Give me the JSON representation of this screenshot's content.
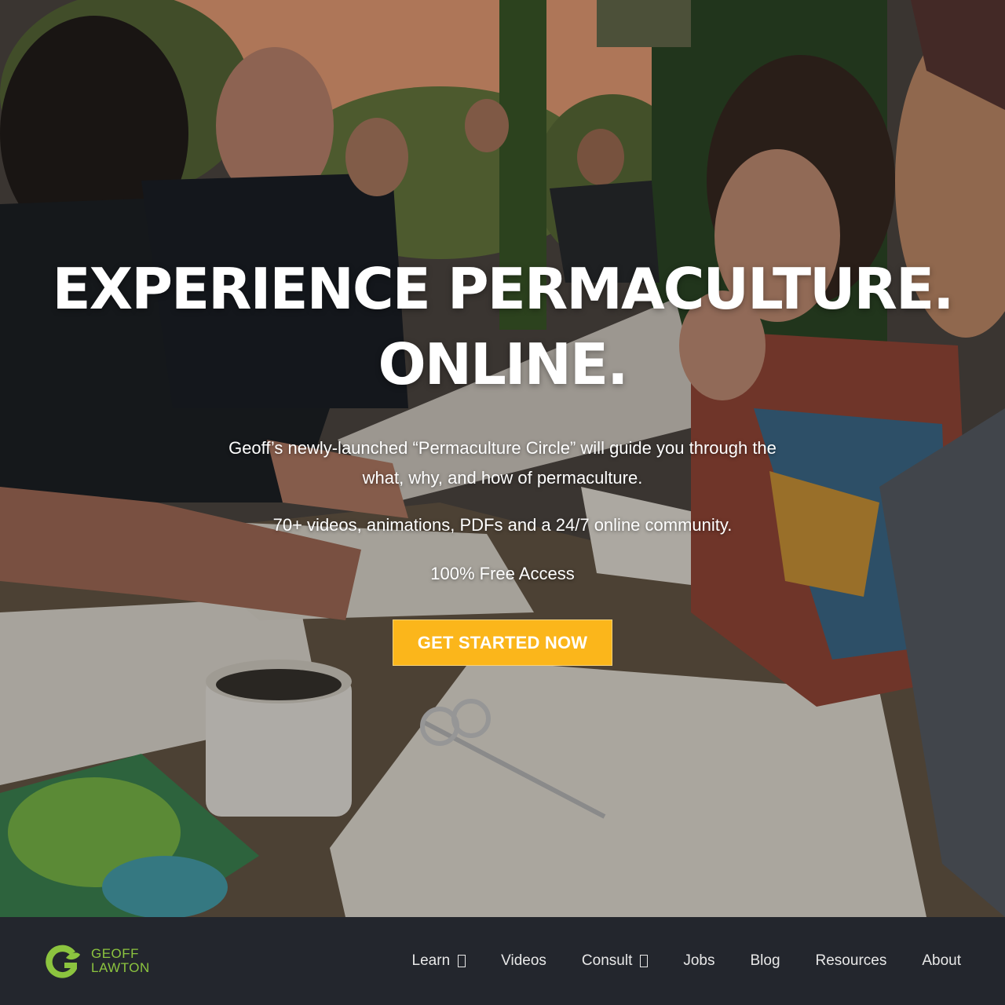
{
  "hero": {
    "headline_line1": "EXPERIENCE PERMACULTURE.",
    "headline_line2": "ONLINE.",
    "description": "Geoff’s newly-launched “Permaculture Circle” will guide you through the what, why, and how of permaculture.",
    "features": "70+ videos, animations, PDFs and a 24/7 online community.",
    "access": "100% Free Access",
    "cta_label": "GET STARTED NOW",
    "background_icon": "photo-people-at-table"
  },
  "brand": {
    "line1": "GEOFF",
    "line2": "LAWTON",
    "accent": "#8cc43f"
  },
  "nav": {
    "items": [
      {
        "label": "Learn",
        "has_dropdown": true
      },
      {
        "label": "Videos",
        "has_dropdown": false
      },
      {
        "label": "Consult",
        "has_dropdown": true
      },
      {
        "label": "Jobs",
        "has_dropdown": false
      },
      {
        "label": "Blog",
        "has_dropdown": false
      },
      {
        "label": "Resources",
        "has_dropdown": false
      },
      {
        "label": "About",
        "has_dropdown": false
      }
    ]
  },
  "colors": {
    "cta": "#fbb61b",
    "navbar": "#23262d",
    "text": "#ffffff"
  }
}
